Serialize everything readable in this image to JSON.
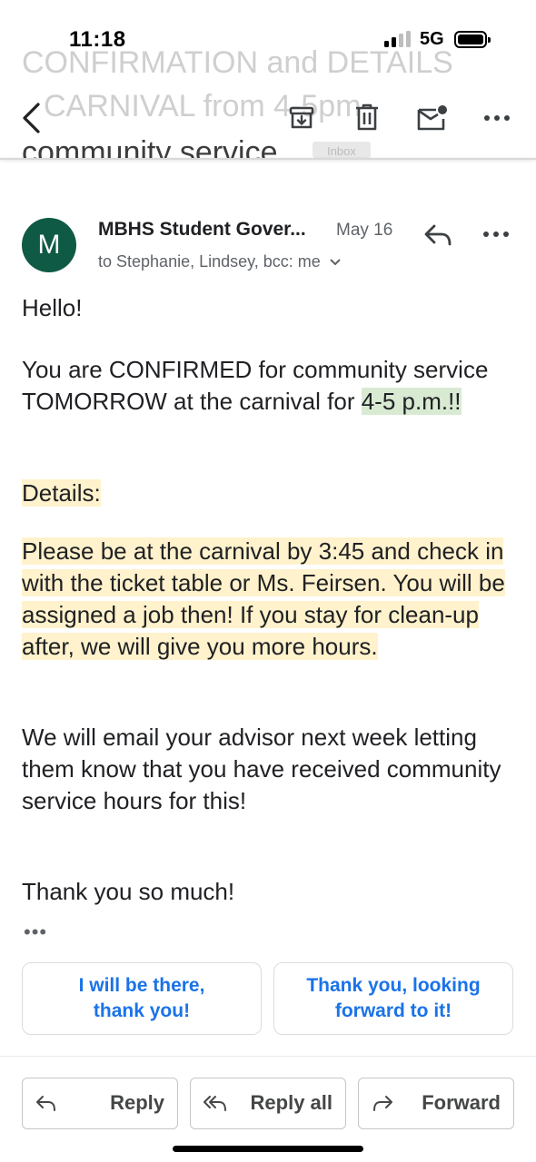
{
  "status": {
    "time": "11:18",
    "network": "5G"
  },
  "subject": {
    "line1": "CONFIRMATION and DETAILS",
    "line2": "CARNIVAL from 4-5pm",
    "line3": "community service",
    "label": "Inbox"
  },
  "toolbar": {
    "back": "back-icon",
    "archive": "archive-icon",
    "delete": "trash-icon",
    "mark_unread": "mail-icon",
    "more": "more-icon"
  },
  "message": {
    "avatar_letter": "M",
    "sender": "MBHS Student Gover...",
    "date": "May 16",
    "recipients": "to Stephanie, Lindsey, bcc: me",
    "greeting": "Hello!",
    "confirm_pre": "You are CONFIRMED for community service TOMORROW at the carnival for ",
    "confirm_hl": "4-5 p.m.!!",
    "details": "Details: ",
    "please": "Please be at the carnival by 3:45 and check in with the ticket table or Ms. Feirsen. You will be assigned a job then! If you stay for clean-up after, we will give you more hours. ",
    "advisor": "We will email your advisor next week letting them know that you have received community service hours for this!",
    "thanks": "Thank you so much!",
    "trimmed": "•••"
  },
  "smart_replies": [
    {
      "label": "I will be there, thank you!"
    },
    {
      "label": "Thank you, looking forward to it!"
    }
  ],
  "actions": {
    "reply": "Reply",
    "reply_all": "Reply all",
    "forward": "Forward"
  },
  "colors": {
    "avatar": "#0f5a44",
    "link": "#1a73e8",
    "highlight_green": "#d9ead3",
    "highlight_yellow": "#fff2cc"
  }
}
